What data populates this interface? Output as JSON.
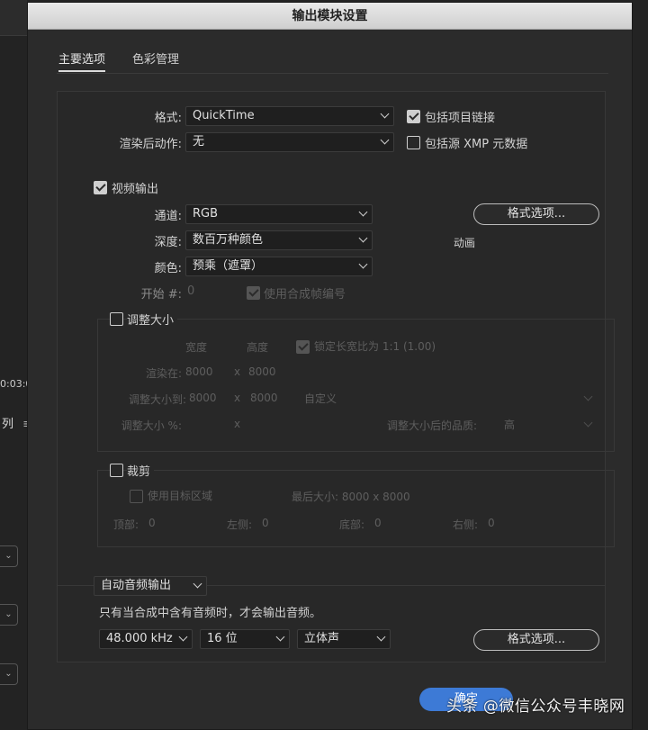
{
  "dialog": {
    "title": "输出模块设置"
  },
  "tabs": [
    {
      "label": "主要选项",
      "active": true
    },
    {
      "label": "色彩管理",
      "active": false
    }
  ],
  "background": {
    "time": "0:03:0",
    "list_label": "列",
    "list_icon": "≡"
  },
  "main": {
    "format_label": "格式:",
    "format_value": "QuickTime",
    "include_project_link_label": "包括项目链接",
    "include_project_link_checked": true,
    "post_render_label": "渲染后动作:",
    "post_render_value": "无",
    "include_xmp_label": "包括源 XMP 元数据",
    "include_xmp_checked": false
  },
  "video": {
    "output_label": "视频输出",
    "output_checked": true,
    "channel_label": "通道:",
    "channel_value": "RGB",
    "depth_label": "深度:",
    "depth_value": "数百万种颜色",
    "color_label": "颜色:",
    "color_value": "预乘（遮罩）",
    "format_options_button": "格式选项...",
    "codec_text": "动画",
    "start_label": "开始 #:",
    "start_value": "0",
    "use_comp_frame_label": "使用合成帧编号",
    "use_comp_frame_checked": true
  },
  "resize": {
    "label": "调整大小",
    "checked": false,
    "width_header": "宽度",
    "height_header": "高度",
    "lock_aspect_label": "锁定长宽比为 1:1 (1.00)",
    "lock_aspect_checked": true,
    "render_at_label": "渲染在:",
    "render_at_w": "8000",
    "render_at_x": "x",
    "render_at_h": "8000",
    "resize_to_label": "调整大小到:",
    "resize_to_w": "8000",
    "resize_to_x": "x",
    "resize_to_h": "8000",
    "resize_to_preset": "自定义",
    "resize_pct_label": "调整大小 %:",
    "resize_pct_x": "x",
    "quality_label": "调整大小后的品质:",
    "quality_value": "高"
  },
  "crop": {
    "label": "裁剪",
    "checked": false,
    "use_roi_label": "使用目标区域",
    "use_roi_checked": false,
    "final_size_label": "最后大小: 8000 x 8000",
    "top_label": "顶部:",
    "top_value": "0",
    "left_label": "左侧:",
    "left_value": "0",
    "bottom_label": "底部:",
    "bottom_value": "0",
    "right_label": "右侧:",
    "right_value": "0"
  },
  "audio": {
    "output_mode": "自动音频输出",
    "note": "只有当合成中含有音频时，才会输出音频。",
    "sample_rate": "48.000 kHz",
    "bit_depth": "16 位",
    "channels": "立体声",
    "format_options_button": "格式选项..."
  },
  "footer": {
    "ok_button": "确定"
  },
  "watermark": "头条 @微信公众号丰晓网"
}
